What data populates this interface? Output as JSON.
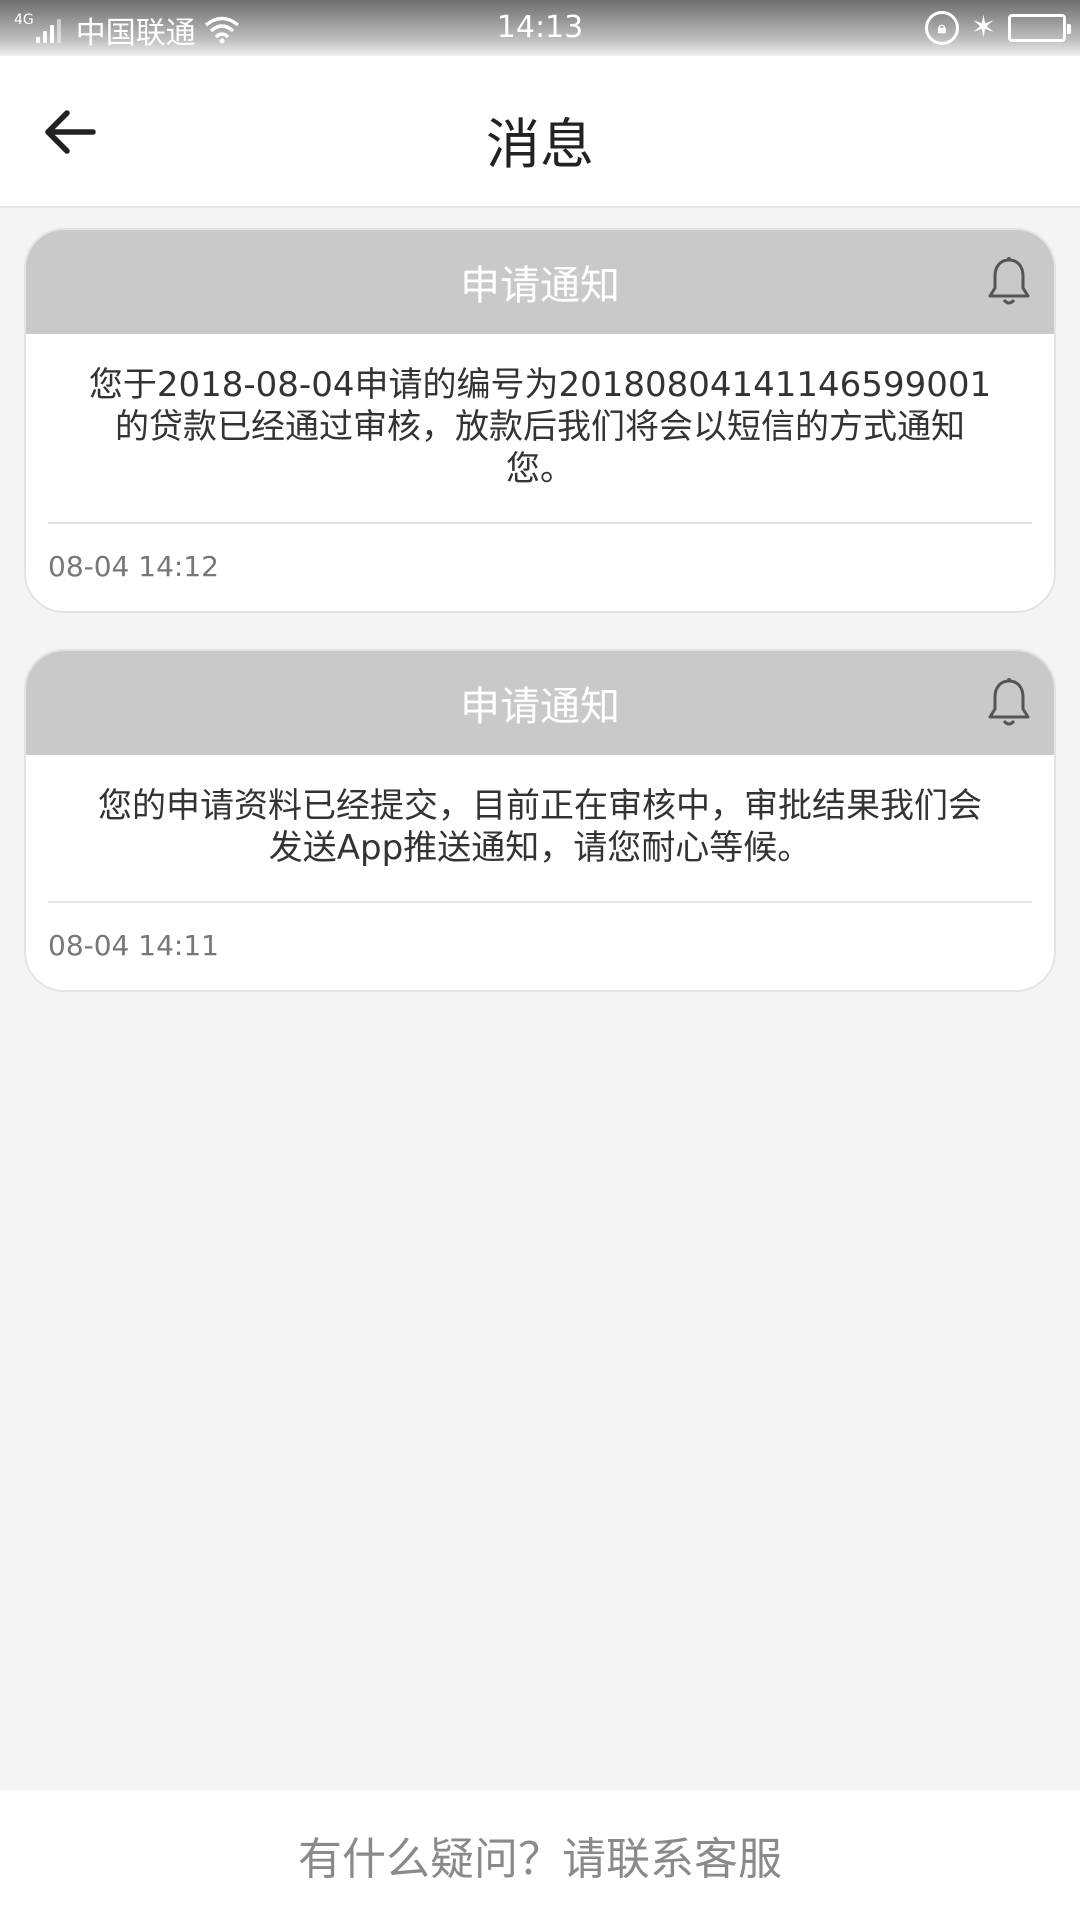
{
  "status_bar": {
    "network_type": "4G",
    "carrier": "中国联通",
    "time": "14:13",
    "icons": [
      "signal-icon",
      "wifi-icon",
      "rotation-lock-icon",
      "bluetooth-icon",
      "battery-icon"
    ]
  },
  "nav": {
    "back_icon": "arrow-left-icon",
    "title": "消息"
  },
  "messages": [
    {
      "title": "申请通知",
      "icon": "bell-icon",
      "body": "您于2018-08-04申请的编号为20180804141146599001的贷款已经通过审核，放款后我们将会以短信的方式通知您。",
      "time": "08-04 14:12"
    },
    {
      "title": "申请通知",
      "icon": "bell-icon",
      "body": "您的申请资料已经提交，目前正在审核中，审批结果我们会发送App推送通知，请您耐心等候。",
      "time": "08-04 14:11"
    }
  ],
  "footer": {
    "support_text": "有什么疑问？请联系客服"
  },
  "colors": {
    "card_header_bg": "#c9c9c9",
    "page_bg": "#f4f4f4",
    "text_primary": "#333333",
    "text_muted": "#777777"
  }
}
